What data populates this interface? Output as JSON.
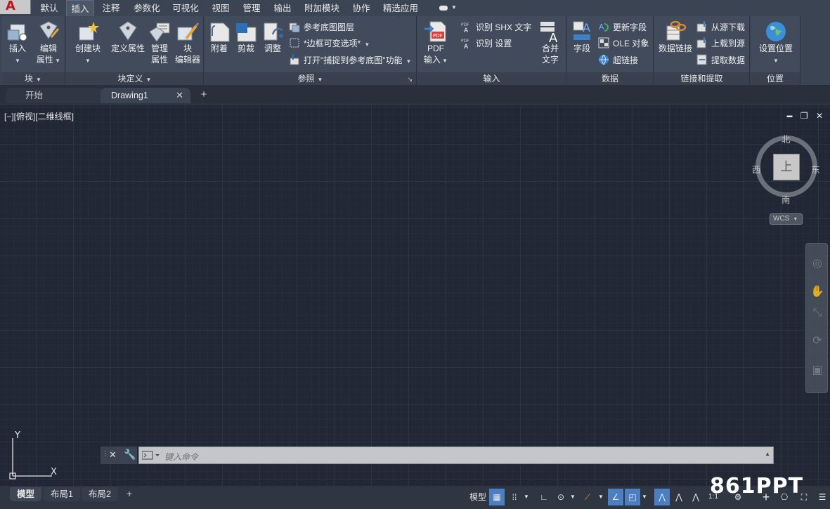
{
  "menu_tabs": [
    "默认",
    "插入",
    "注释",
    "参数化",
    "可视化",
    "视图",
    "管理",
    "输出",
    "附加模块",
    "协作",
    "精选应用"
  ],
  "active_menu_tab": "插入",
  "ribbon": {
    "block": {
      "title": "块",
      "insert": "插入",
      "edit_attr_1": "编辑",
      "edit_attr_2": "属性"
    },
    "block_def": {
      "title": "块定义",
      "create_block": "创建块",
      "define_attr": "定义属性",
      "manage_attr_1": "管理",
      "manage_attr_2": "属性",
      "block_editor_1": "块",
      "block_editor_2": "编辑器"
    },
    "reference": {
      "title": "参照",
      "attach": "附着",
      "clip": "剪裁",
      "adjust": "调整",
      "underlay_layers": "参考底图图层",
      "frames": "*边框可变选项*",
      "snap_underlay": "打开\"捕捉到参考底图\"功能"
    },
    "import": {
      "title": "输入",
      "pdf_1": "PDF",
      "pdf_2": "输入",
      "recognize_shx": "识别 SHX 文字",
      "recognize_settings": "识别 设置",
      "combine_1": "合并",
      "combine_2": "文字"
    },
    "data": {
      "title": "数据",
      "field": "字段",
      "update_fields": "更新字段",
      "ole_object": "OLE 对象",
      "hyperlink": "超链接"
    },
    "linking": {
      "title": "链接和提取",
      "data_link": "数据链接",
      "download_source": "从源下载",
      "upload_source": "上载到源",
      "extract_data": "提取数据"
    },
    "location": {
      "title": "位置",
      "set_location": "设置位置"
    }
  },
  "file_tabs": {
    "start": "开始",
    "drawing": "Drawing1",
    "close": "✕",
    "add": "+"
  },
  "viewport": {
    "label": "[−][俯视][二维线框]",
    "minimize": "▬",
    "restore": "❐",
    "close": "✕"
  },
  "viewcube": {
    "north": "北",
    "south": "南",
    "west": "西",
    "east": "东",
    "face": "上",
    "wcs": "WCS"
  },
  "ucs": {
    "y": "Y",
    "x": "X"
  },
  "command_line": {
    "placeholder": "键入命令"
  },
  "layout_tabs": {
    "model": "模型",
    "layout1": "布局1",
    "layout2": "布局2",
    "add": "+"
  },
  "status": {
    "model": "模型",
    "scale": "1:1"
  },
  "watermark": "861PPT",
  "colors": {
    "background": "#212734",
    "ribbon": "#414b5b",
    "accent_blue": "#4b7fc0",
    "app_red": "#c0141e"
  }
}
